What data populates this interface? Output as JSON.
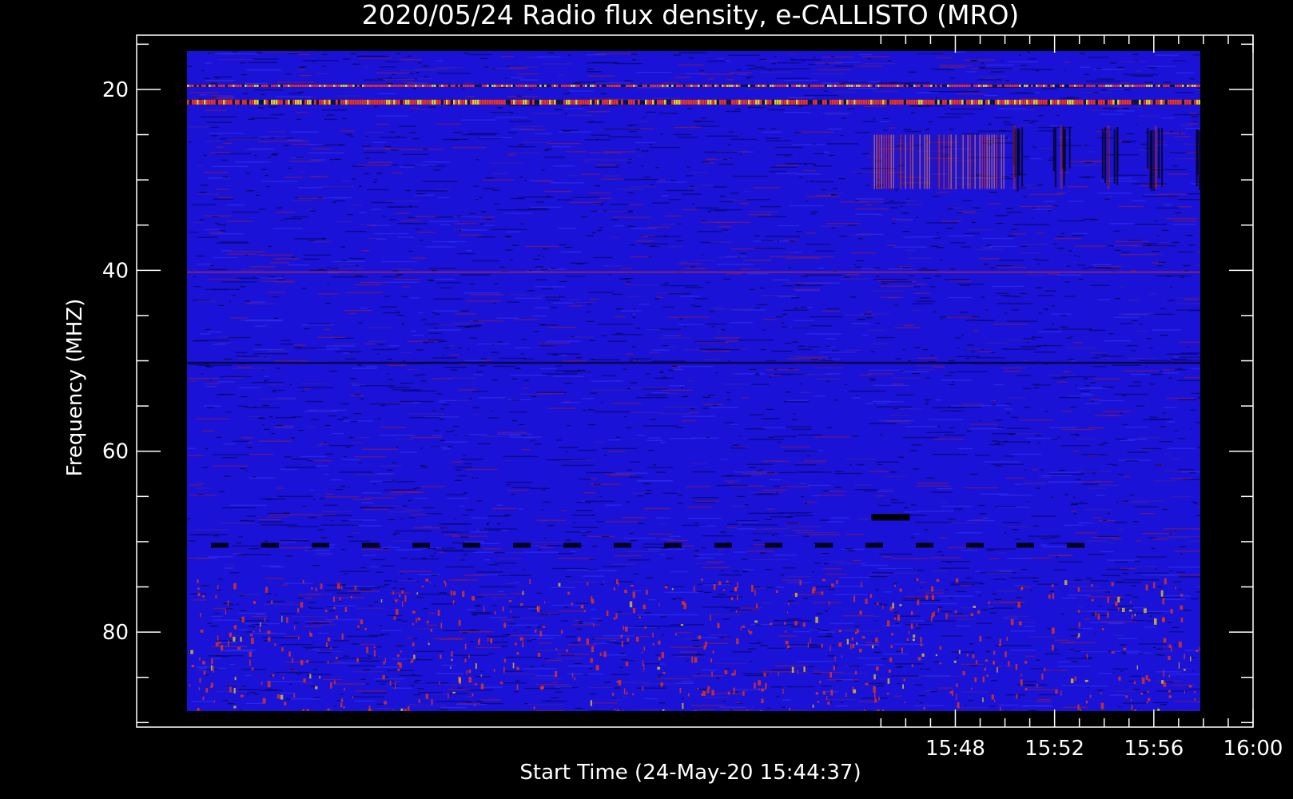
{
  "chart_data": {
    "type": "heatmap",
    "title": "2020/05/24  Radio flux density, e-CALLISTO (MRO)",
    "xlabel": "Start Time (24-May-20 15:44:37)",
    "ylabel": "Frequency (MHZ)",
    "x_time_range": [
      "15:44:37",
      "16:00:00"
    ],
    "xlim_minutes": [
      15.0,
      60.0
    ],
    "x_ticks": [
      {
        "value": 48,
        "label": "15:48"
      },
      {
        "value": 52,
        "label": "15:52"
      },
      {
        "value": 56,
        "label": "15:56"
      },
      {
        "value": 60,
        "label": "16:00"
      }
    ],
    "y_range_mhz": [
      16,
      90
    ],
    "y_plot_range_mhz": [
      14,
      90.5
    ],
    "y_axis_inverted": true,
    "y_ticks": [
      {
        "value": 20,
        "label": "20"
      },
      {
        "value": 40,
        "label": "40"
      },
      {
        "value": 60,
        "label": "60"
      },
      {
        "value": 80,
        "label": "80"
      }
    ],
    "colors": {
      "background": "#000000",
      "low": "#1a12d6",
      "mid": "#2d2ef2",
      "high": "#ff3a00",
      "peak": "#ffe000"
    },
    "features": [
      {
        "kind": "bright_band",
        "freq_mhz": 19.6,
        "intensity": "high"
      },
      {
        "kind": "bright_band",
        "freq_mhz": 21.4,
        "intensity": "very_high"
      },
      {
        "kind": "interference_block",
        "freq_range_mhz": [
          25,
          31
        ],
        "time_range": [
          "15:44:37",
          "15:50:00"
        ]
      },
      {
        "kind": "periodic_dark_striations",
        "freq_range_mhz": [
          24,
          31
        ],
        "time_range": [
          "15:50:00",
          "16:00:00"
        ]
      },
      {
        "kind": "weak_band",
        "freq_mhz": 40.2
      },
      {
        "kind": "dark_band",
        "freq_mhz": 50.2
      },
      {
        "kind": "dashed_dark_band",
        "freq_mhz": 70.4
      },
      {
        "kind": "dark_segment",
        "freq_mhz": 67.3,
        "time_range": [
          "15:44:37",
          "15:46:10"
        ]
      },
      {
        "kind": "dark_gap",
        "freq_range_mhz": [
          51,
          84
        ],
        "time_range": [
          "15:59:00",
          "16:00:00"
        ]
      },
      {
        "kind": "red_noise_region",
        "freq_range_mhz": [
          74,
          90
        ]
      }
    ]
  }
}
